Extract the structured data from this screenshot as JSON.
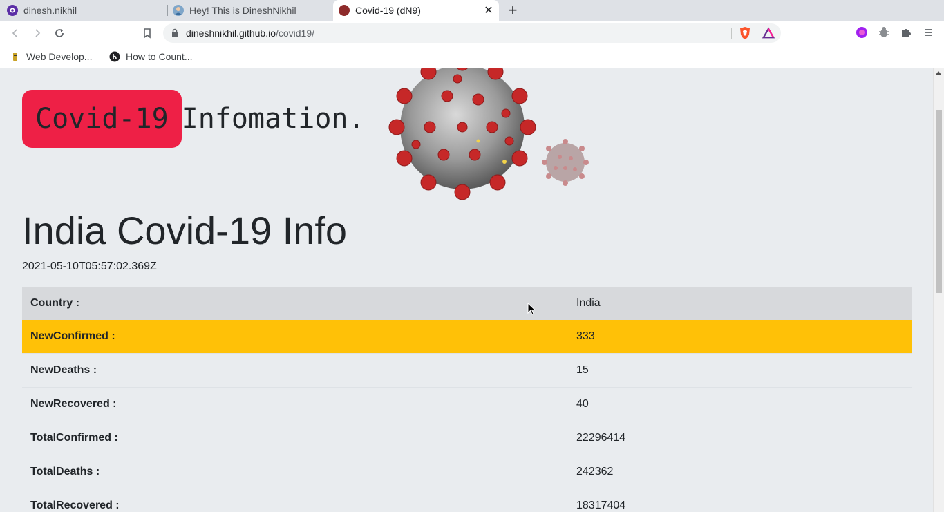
{
  "tabs": [
    {
      "label": "dinesh.nikhil"
    },
    {
      "label": "Hey! This is DineshNikhil"
    },
    {
      "label": "Covid-19 (dN9)",
      "active": true
    }
  ],
  "address_bar": {
    "host": "dineshnikhil.github.io",
    "path": "/covid19/"
  },
  "bookmarks": [
    {
      "label": "Web Develop..."
    },
    {
      "label": "How to Count..."
    }
  ],
  "page": {
    "badge_text": "Covid-19",
    "hero_text": "Infomation.",
    "heading": "India Covid-19 Info",
    "timestamp": "2021-05-10T05:57:02.369Z",
    "rows": [
      {
        "key": "Country :",
        "value": "India"
      },
      {
        "key": "NewConfirmed :",
        "value": "333"
      },
      {
        "key": "NewDeaths :",
        "value": "15"
      },
      {
        "key": "NewRecovered :",
        "value": "40"
      },
      {
        "key": "TotalConfirmed :",
        "value": "22296414"
      },
      {
        "key": "TotalDeaths :",
        "value": "242362"
      },
      {
        "key": "TotalRecovered :",
        "value": "18317404"
      }
    ]
  },
  "colors": {
    "badge": "#ee2046",
    "highlight_row": "#ffc107",
    "header_row": "#d7d9dc",
    "page_bg": "#e9ecef"
  }
}
